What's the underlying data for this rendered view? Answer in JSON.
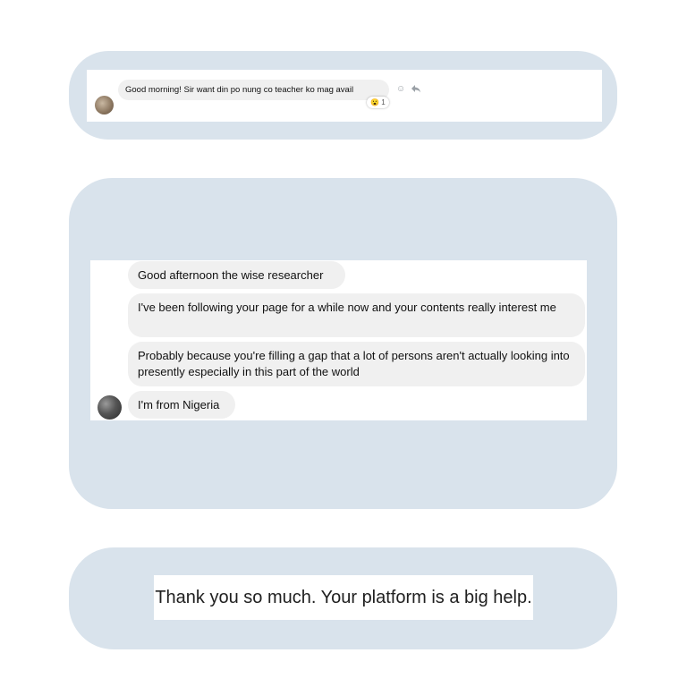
{
  "screenshot_1": {
    "message": "Good morning! Sir want din po nung co teacher ko mag avail",
    "reaction": {
      "emoji": "😮",
      "count": "1"
    },
    "actions": {
      "react_icon": "☺",
      "reply_icon": "🡸"
    },
    "icons": [
      "avatar",
      "smiley-icon",
      "reply-icon",
      "surprised-emoji-icon"
    ]
  },
  "screenshot_2": {
    "messages": [
      "Good afternoon the wise researcher",
      "I've been following your page for a while now and your contents really interest me",
      "Probably because you're filling a gap that a lot of persons aren't actually looking into presently especially in this part of the world",
      "I'm from Nigeria"
    ]
  },
  "screenshot_3": {
    "text": "Thank you so much. Your platform is a big help."
  },
  "colors": {
    "card_background": "#d9e3ec",
    "bubble_background": "#f0f0f0",
    "panel_background": "#ffffff"
  }
}
